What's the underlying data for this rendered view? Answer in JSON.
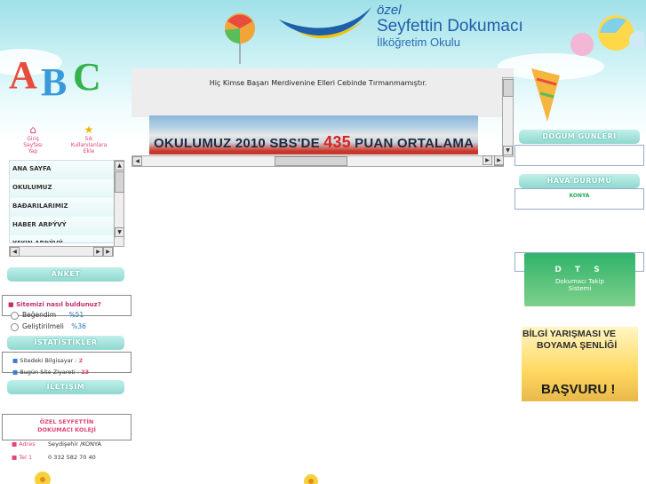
{
  "header": {
    "school_line1": "özel",
    "school_line2": "Seyfettin Dokumacı",
    "school_line3": "İlköğretim Okulu"
  },
  "quick_links": {
    "home_label_1": "Giriş",
    "home_label_2": "Sayfası",
    "home_label_3": "Yap",
    "fav_label_1": "Sık",
    "fav_label_2": "Kullanılanlara",
    "fav_label_3": "Ekle"
  },
  "menu": {
    "items": [
      "ANA SAYFA",
      "OKULUMUZ",
      "BAÐARILARIMIZ",
      "HABER ARÞÝVÝ",
      "YAYIN ARÞÝVÝ"
    ]
  },
  "poll": {
    "title": "ANKET",
    "question": "Sitemizi nasıl buldunuz?",
    "option1": "Beğendim",
    "option1_value": "%51",
    "option2": "Geliştirilmeli",
    "option2_value": "%36"
  },
  "stats": {
    "title": "İSTATİSTİKLER",
    "online_label": "Sitedeki Bilgisayar :",
    "online_value": "2",
    "visits_label": "Bugün Site Ziyareti :",
    "visits_value": "23"
  },
  "contact": {
    "title": "İLETİŞİM",
    "org_line1": "ÖZEL SEYFETTİN",
    "org_line2": "DOKUMACI KOLEJİ",
    "address_label": "Adres",
    "address_value": "Seydişehir /KONYA",
    "phone_label": "Tel 1",
    "phone_value": "0 332 582 70 40"
  },
  "center": {
    "motto": "Hiç Kimse Başarı Merdivenine Elleri Cebinde Tırmanmamıştır.",
    "banner_prefix": "OKULUMUZ 2010 SBS'DE",
    "banner_number": "435",
    "banner_suffix": "PUAN ORTALAMA"
  },
  "right": {
    "birthdays_title": "DOĞUM GÜNLERİ",
    "weather_title": "HAVA DURUMU",
    "weather_city": "KONYA",
    "dts_title": "D T S",
    "dts_line1": "Dokumacı Takip",
    "dts_line2": "Sistemi",
    "contest_line1": "BİLGİ YARIŞMASI VE",
    "contest_line2": "BOYAMA ŞENLİĞİ",
    "contest_button": "BAŞVURU !"
  },
  "colors": {
    "accent_pink": "#e0457b",
    "title_teal": "#8fd8cf",
    "school_blue": "#1f5fa8"
  }
}
